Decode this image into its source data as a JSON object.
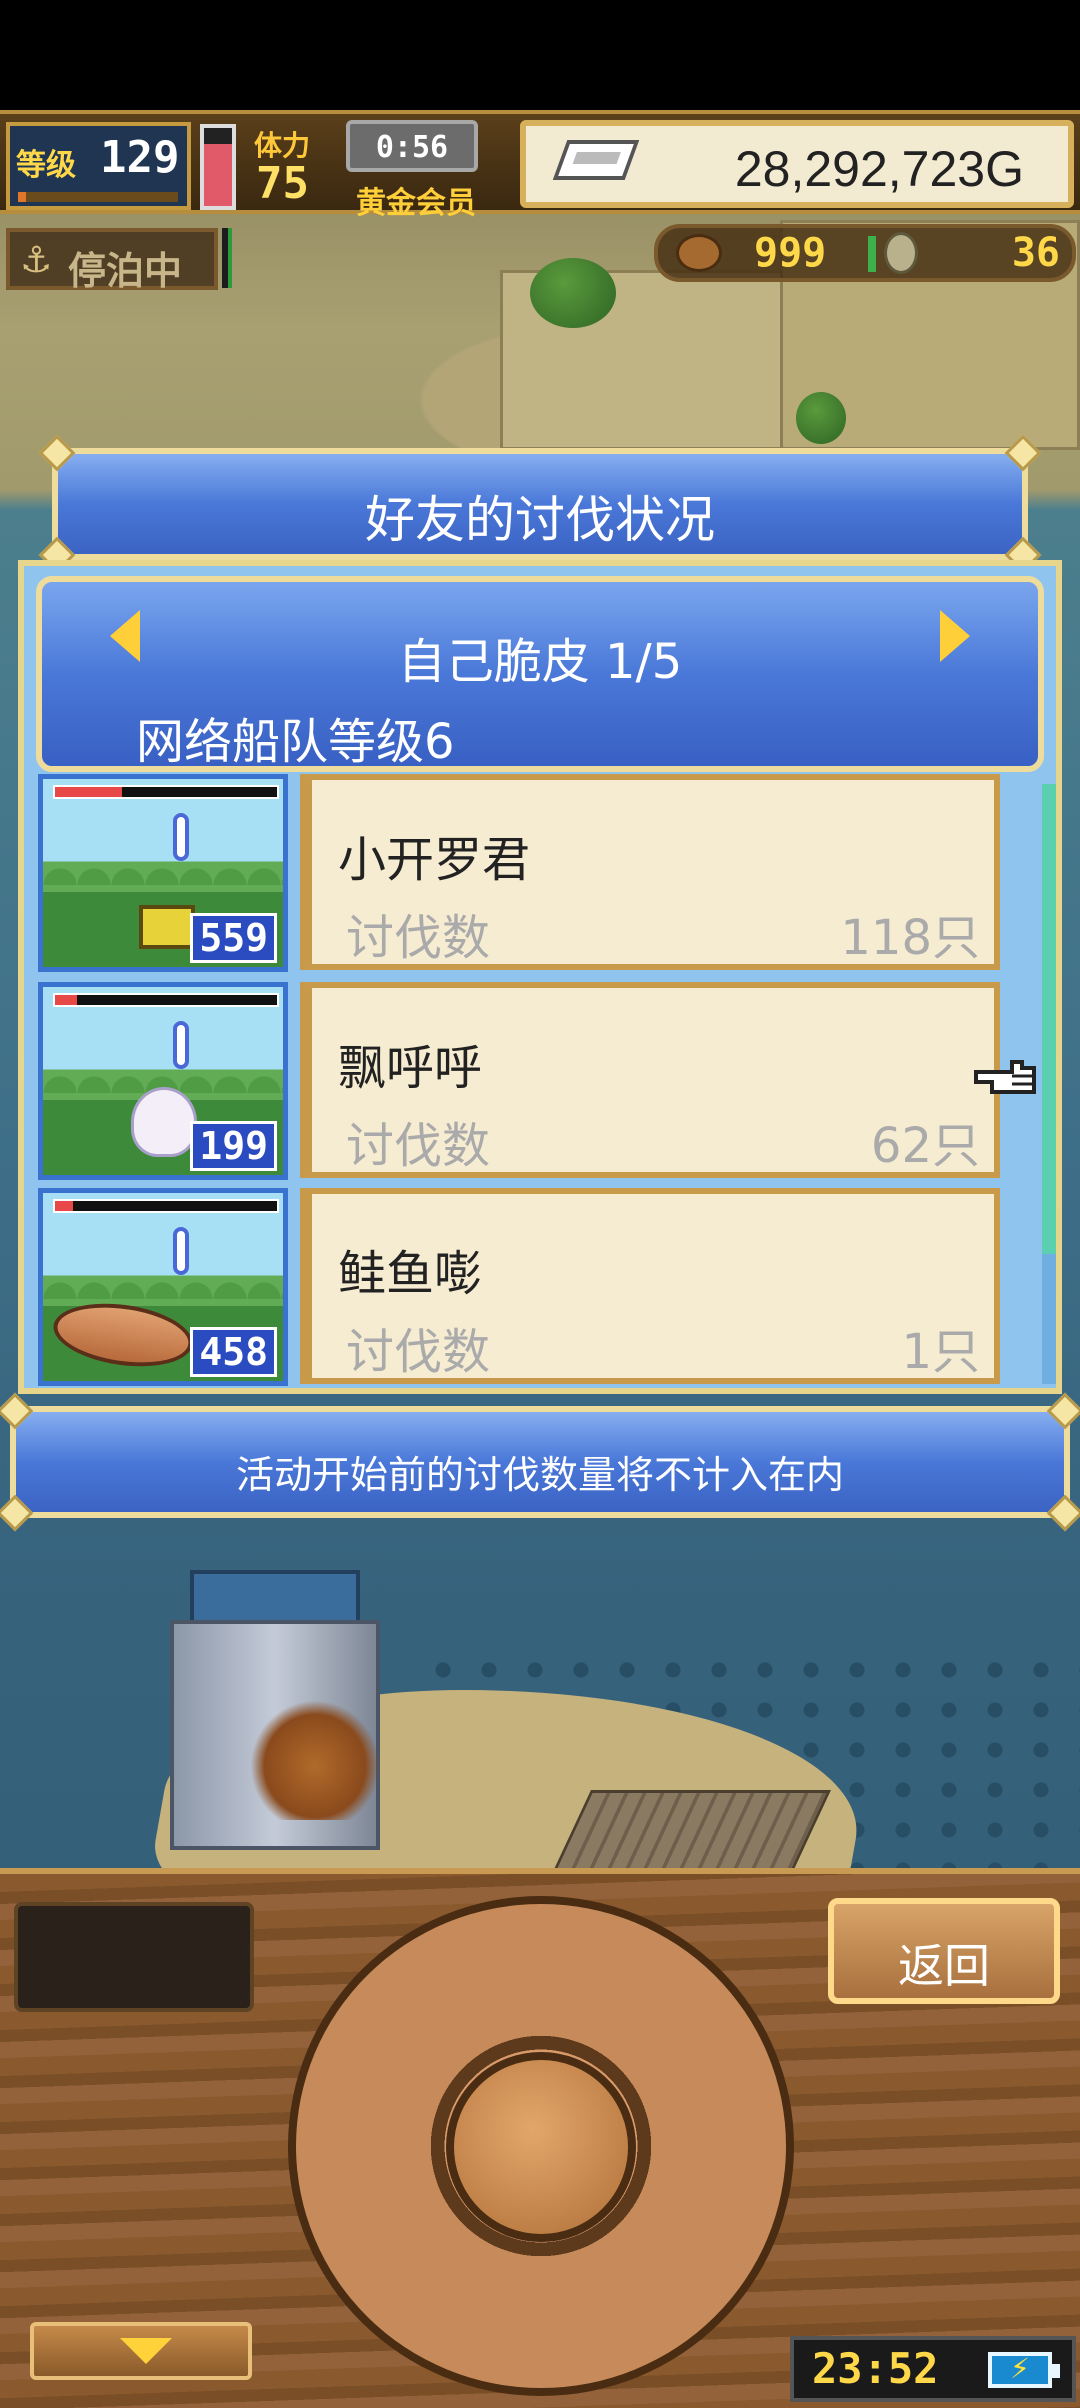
{
  "status": {
    "level_label": "等级",
    "level_value": "129",
    "level_progress": 0.05,
    "hp_fraction": 0.8,
    "stamina_label": "体力",
    "stamina_value": "75",
    "timer": "0:56",
    "membership": "黄金会员",
    "gold": "28,292,723G",
    "dock_status": "停泊中",
    "resource_1_value": "999",
    "resource_2_value": "36",
    "icons": {
      "anchor": "anchor-icon",
      "gold": "gold-bar-icon",
      "resource_1": "meat-icon",
      "resource_2": "coin-icon"
    }
  },
  "dialog": {
    "title": "好友的讨伐状况",
    "friend_name": "自己脆皮 1/5",
    "fleet_level": "网络船队等级6",
    "prev_icon": "triangle-left-icon",
    "next_icon": "triangle-right-icon",
    "rows": [
      {
        "name": "小开罗君",
        "label": "讨伐数",
        "value": "118只",
        "monster_count": "559",
        "hp": 0.3
      },
      {
        "name": "飘呼呼",
        "label": "讨伐数",
        "value": "62只",
        "monster_count": "199",
        "hp": 0.1
      },
      {
        "name": "鲑鱼嘭",
        "label": "讨伐数",
        "value": "1只",
        "monster_count": "458",
        "hp": 0.08
      }
    ],
    "scroll_position": 0.0,
    "note": "活动开始前的讨伐数量将不计入在内"
  },
  "controls": {
    "back_label": "返回",
    "clock": "23:52",
    "battery_symbol": "⚡",
    "down_icon": "triangle-down-icon"
  },
  "colors": {
    "dialog_blue": "#4a78d8",
    "card_bg": "#f6ecd2",
    "gold_text": "#ffd84a",
    "hp_red": "#e84848"
  }
}
